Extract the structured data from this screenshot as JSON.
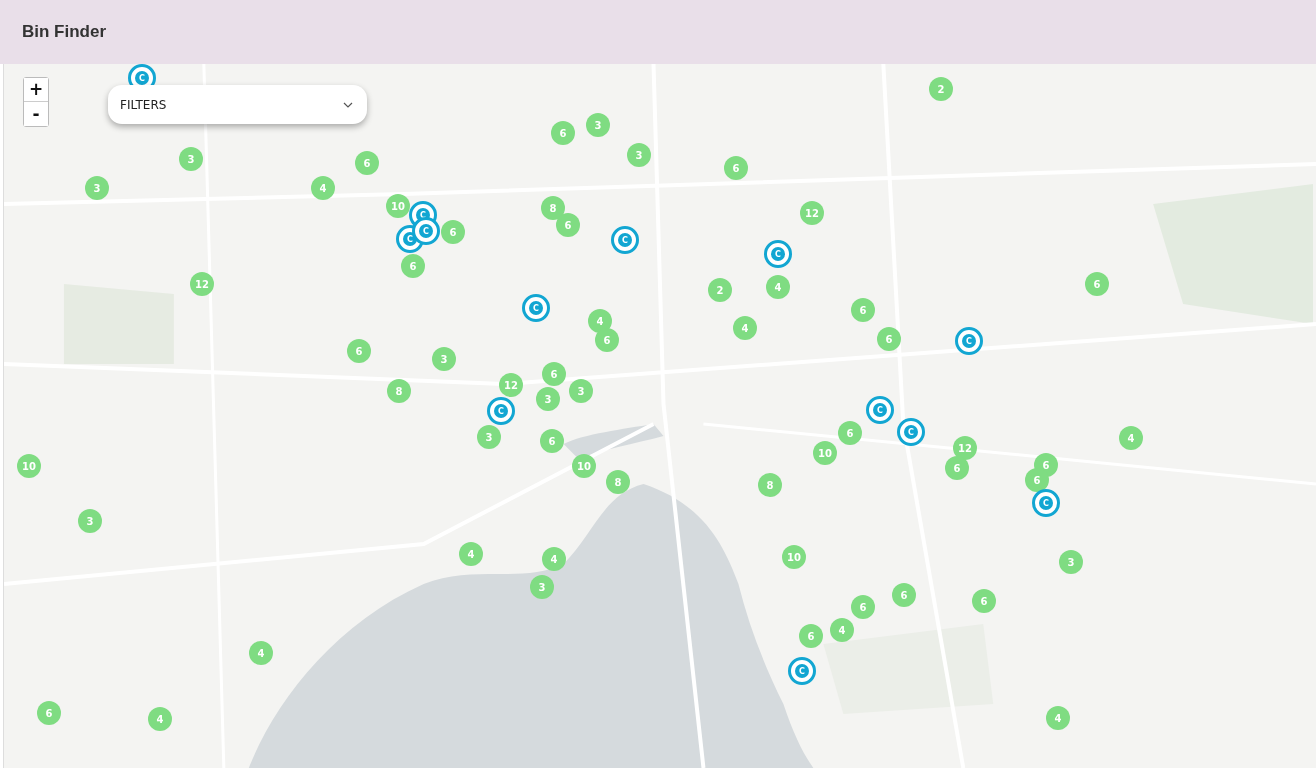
{
  "header": {
    "title": "Bin Finder"
  },
  "zoom_controls": {
    "zoom_in": "+",
    "zoom_out": "-"
  },
  "filters": {
    "label": "FILTERS"
  },
  "map": {
    "kind": "picture",
    "markers": [
      {
        "kind": "station",
        "label": "C"
      },
      {
        "kind": "cluster",
        "label": "2"
      },
      {
        "kind": "cluster",
        "label": "6"
      },
      {
        "kind": "cluster",
        "label": "3"
      },
      {
        "kind": "cluster",
        "label": "3"
      },
      {
        "kind": "cluster",
        "label": "6"
      },
      {
        "kind": "cluster",
        "label": "3"
      },
      {
        "kind": "cluster",
        "label": "6"
      },
      {
        "kind": "cluster",
        "label": "3"
      },
      {
        "kind": "cluster",
        "label": "4"
      },
      {
        "kind": "cluster",
        "label": "10"
      },
      {
        "kind": "station",
        "label": "C"
      },
      {
        "kind": "cluster",
        "label": "8"
      },
      {
        "kind": "cluster",
        "label": "12"
      },
      {
        "kind": "station",
        "label": "C"
      },
      {
        "kind": "station",
        "label": "C"
      },
      {
        "kind": "cluster",
        "label": "6"
      },
      {
        "kind": "cluster",
        "label": "6"
      },
      {
        "kind": "station",
        "label": "C"
      },
      {
        "kind": "station",
        "label": "C"
      },
      {
        "kind": "cluster",
        "label": "6"
      },
      {
        "kind": "cluster",
        "label": "12"
      },
      {
        "kind": "cluster",
        "label": "2"
      },
      {
        "kind": "cluster",
        "label": "4"
      },
      {
        "kind": "cluster",
        "label": "6"
      },
      {
        "kind": "station",
        "label": "C"
      },
      {
        "kind": "cluster",
        "label": "6"
      },
      {
        "kind": "cluster",
        "label": "4"
      },
      {
        "kind": "cluster",
        "label": "4"
      },
      {
        "kind": "cluster",
        "label": "6"
      },
      {
        "kind": "cluster",
        "label": "6"
      },
      {
        "kind": "cluster",
        "label": "6"
      },
      {
        "kind": "station",
        "label": "C"
      },
      {
        "kind": "cluster",
        "label": "3"
      },
      {
        "kind": "cluster",
        "label": "6"
      },
      {
        "kind": "cluster",
        "label": "8"
      },
      {
        "kind": "cluster",
        "label": "12"
      },
      {
        "kind": "cluster",
        "label": "3"
      },
      {
        "kind": "cluster",
        "label": "3"
      },
      {
        "kind": "station",
        "label": "C"
      },
      {
        "kind": "station",
        "label": "C"
      },
      {
        "kind": "cluster",
        "label": "3"
      },
      {
        "kind": "cluster",
        "label": "6"
      },
      {
        "kind": "cluster",
        "label": "6"
      },
      {
        "kind": "station",
        "label": "C"
      },
      {
        "kind": "cluster",
        "label": "4"
      },
      {
        "kind": "cluster",
        "label": "10"
      },
      {
        "kind": "cluster",
        "label": "12"
      },
      {
        "kind": "cluster",
        "label": "10"
      },
      {
        "kind": "cluster",
        "label": "10"
      },
      {
        "kind": "cluster",
        "label": "6"
      },
      {
        "kind": "cluster",
        "label": "6"
      },
      {
        "kind": "cluster",
        "label": "8"
      },
      {
        "kind": "cluster",
        "label": "8"
      },
      {
        "kind": "cluster",
        "label": "6"
      },
      {
        "kind": "station",
        "label": "C"
      },
      {
        "kind": "cluster",
        "label": "3"
      },
      {
        "kind": "cluster",
        "label": "4"
      },
      {
        "kind": "cluster",
        "label": "4"
      },
      {
        "kind": "cluster",
        "label": "10"
      },
      {
        "kind": "cluster",
        "label": "3"
      },
      {
        "kind": "cluster",
        "label": "3"
      },
      {
        "kind": "cluster",
        "label": "6"
      },
      {
        "kind": "cluster",
        "label": "6"
      },
      {
        "kind": "cluster",
        "label": "6"
      },
      {
        "kind": "cluster",
        "label": "6"
      },
      {
        "kind": "cluster",
        "label": "4"
      },
      {
        "kind": "cluster",
        "label": "4"
      },
      {
        "kind": "station",
        "label": "C"
      },
      {
        "kind": "cluster",
        "label": "6"
      },
      {
        "kind": "cluster",
        "label": "4"
      },
      {
        "kind": "cluster",
        "label": "4"
      }
    ]
  }
}
